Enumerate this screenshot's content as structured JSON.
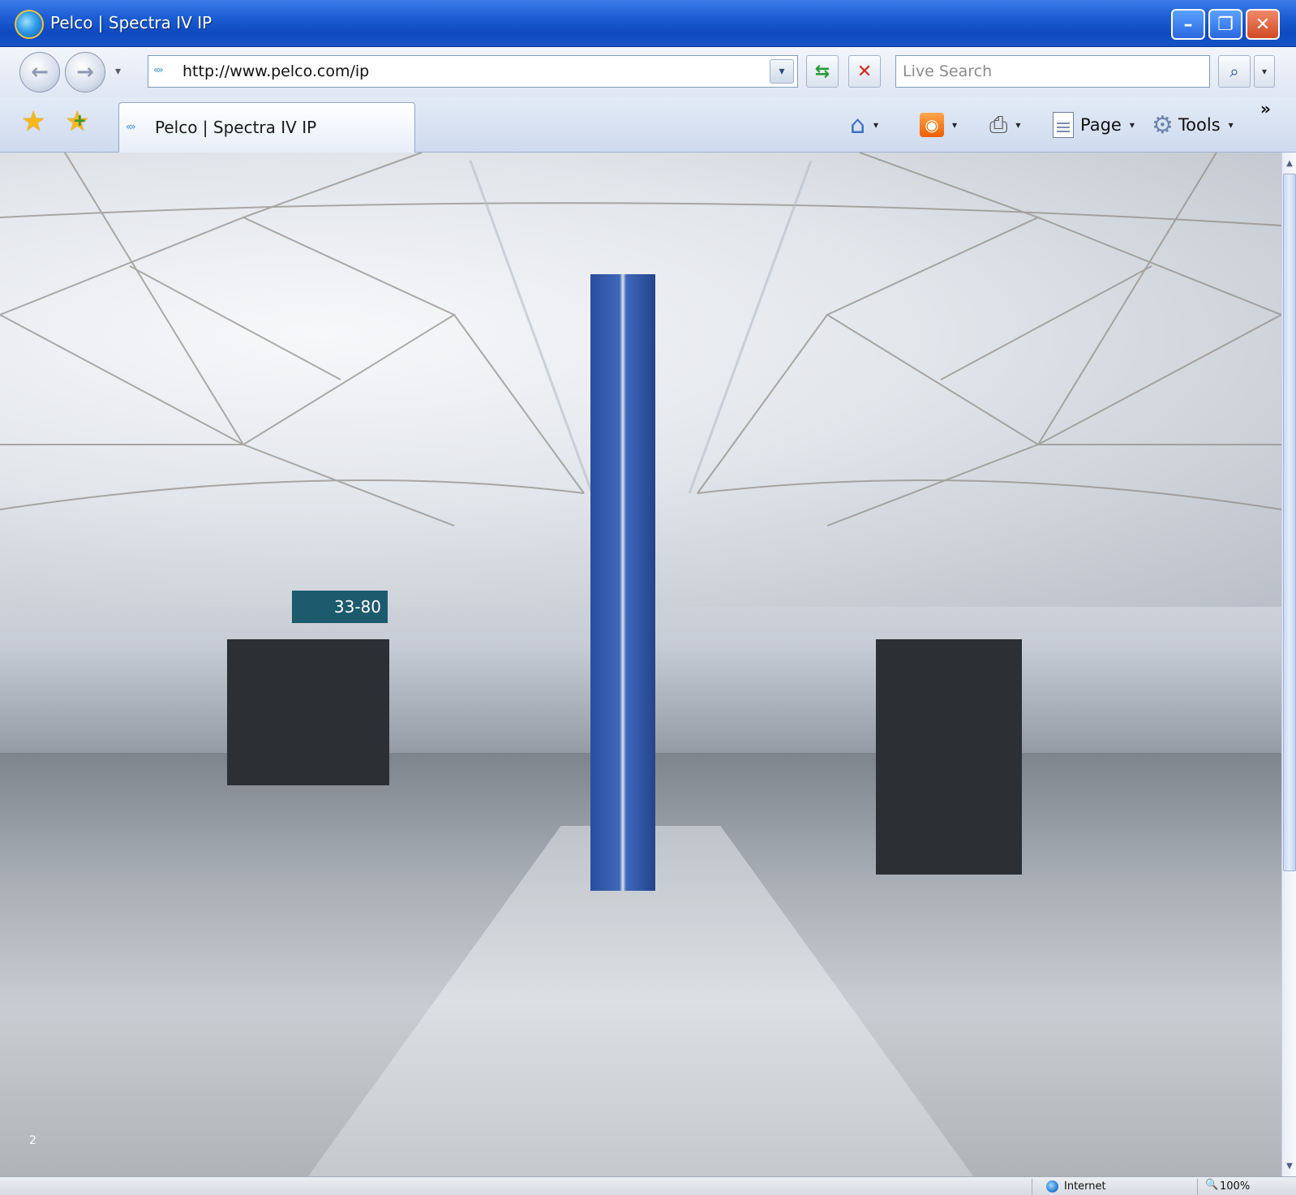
{
  "window": {
    "title": "Pelco | Spectra IV IP",
    "minimize_glyph": "–",
    "maximize_glyph": "❐",
    "close_glyph": "✕"
  },
  "navigation": {
    "back_glyph": "←",
    "forward_glyph": "→",
    "history_dropdown": "▾",
    "address": {
      "url": "http://www.pelco.com/ip",
      "page_icon": "«»",
      "dropdown_glyph": "▾"
    },
    "refresh_glyph": "⇆",
    "stop_glyph": "✕",
    "search": {
      "placeholder": "Live Search",
      "value": "",
      "go_glyph": "⌕",
      "options_glyph": "▾"
    }
  },
  "tabbar": {
    "favorites_glyph": "★",
    "add_favorite_glyph": "★",
    "add_favorite_plus": "+",
    "tab": {
      "label": "Pelco | Spectra IV IP",
      "page_icon": "«»"
    },
    "commands": {
      "home_glyph": "⌂",
      "feeds_glyph": "◉",
      "print_glyph": "⎙",
      "page_label": "Page",
      "tools_label": "Tools",
      "tools_glyph": "⚙",
      "caret": "▾",
      "more_glyph": "»"
    }
  },
  "content": {
    "gate_sign": "33-80",
    "page_number": "2"
  },
  "scrollbar": {
    "up_glyph": "▲",
    "down_glyph": "▼"
  },
  "statusbar": {
    "zone": "Internet",
    "zoom": "100%",
    "zoom_glyph": "🔍"
  },
  "icons": {
    "app": "ie-icon",
    "favorites": "star-icon",
    "add_favorite": "add-favorite-icon",
    "home": "home-icon",
    "feeds": "rss-icon",
    "print": "printer-icon",
    "page": "page-icon",
    "tools": "gear-icon",
    "zone": "globe-icon",
    "zoom": "magnifier-icon"
  },
  "colors": {
    "titlebar": "#1e5fd6",
    "close_button": "#d24a24",
    "stop": "#d6261c",
    "refresh": "#2a9a38",
    "favorites_star": "#f5b81a"
  }
}
